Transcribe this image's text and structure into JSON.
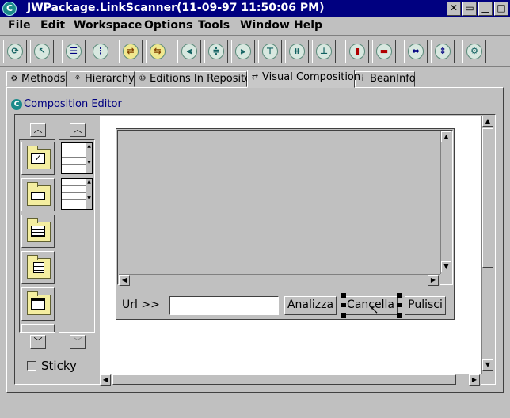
{
  "window": {
    "title": "JWPackage.LinkScanner(11-09-97 11:50:06 PM)",
    "app_icon": "C"
  },
  "menubar": {
    "items": [
      "File",
      "Edit",
      "Workspace",
      "Options",
      "Tools",
      "Window",
      "Help"
    ]
  },
  "toolbar": {
    "icons": [
      "refresh-icon",
      "pointer-icon",
      "list-icon",
      "beans-list-icon",
      "connect-icon",
      "connect2-icon",
      "align-left-icon",
      "align-center-icon",
      "align-right-icon",
      "align-top-icon",
      "align-middle-icon",
      "align-bottom-icon",
      "match-width-icon",
      "match-height-icon",
      "distribute-horizontal-icon",
      "distribute-vertical-icon",
      "settings-gear-icon"
    ]
  },
  "tabs": [
    {
      "label": "Methods",
      "icon": "methods-icon"
    },
    {
      "label": "Hierarchy",
      "icon": "hierarchy-icon"
    },
    {
      "label": "Editions In Repository",
      "icon": "editions-icon"
    },
    {
      "label": "Visual Composition",
      "icon": "visual-composition-icon"
    },
    {
      "label": "BeanInfo",
      "icon": "beaninfo-icon"
    }
  ],
  "editor": {
    "title": "Composition Editor"
  },
  "palette": {
    "sticky_label": "Sticky",
    "checkbox_glyph": "✓"
  },
  "bean": {
    "url_label": "Url >>",
    "url_value": "",
    "buttons": [
      "Analizza",
      "Cancella",
      "Pulisci"
    ]
  }
}
